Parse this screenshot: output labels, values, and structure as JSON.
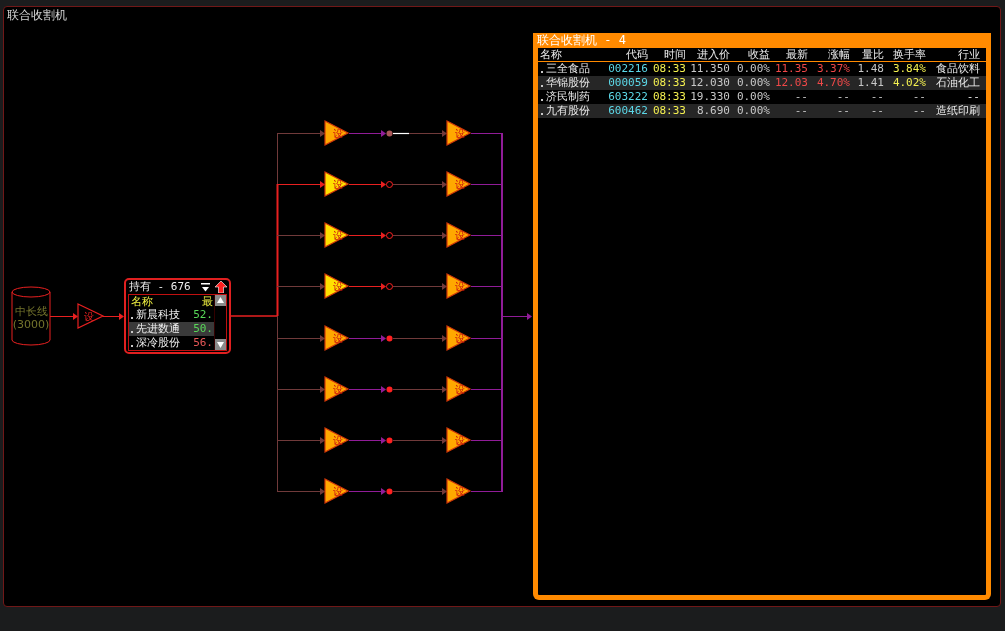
{
  "window": {
    "title": "联合收割机"
  },
  "source": {
    "label": "中长线",
    "count": "(3000)"
  },
  "entry_gate": {
    "label": "设"
  },
  "holdings": {
    "title": "持有 - 676",
    "columns": [
      "名称",
      "最"
    ],
    "rows": [
      {
        "name": "新晨科技",
        "value": "52.",
        "up": false,
        "selected": false
      },
      {
        "name": "先进数通",
        "value": "50.",
        "up": false,
        "selected": true
      },
      {
        "name": "深冷股份",
        "value": "56.",
        "up": true,
        "selected": false
      }
    ]
  },
  "branches": [
    {
      "gate": "设",
      "input_active": false,
      "link_active": false,
      "kind": "faint",
      "trace": true,
      "output_gate": "设"
    },
    {
      "gate": "设",
      "input_active": true,
      "link_active": true,
      "kind": "ring",
      "trace": false,
      "output_gate": "设"
    },
    {
      "gate": "设",
      "input_active": false,
      "link_active": true,
      "kind": "ring",
      "trace": false,
      "output_gate": "设"
    },
    {
      "gate": "设",
      "input_active": false,
      "link_active": true,
      "kind": "ring",
      "trace": false,
      "output_gate": "设"
    },
    {
      "gate": "设",
      "input_active": false,
      "link_active": false,
      "kind": "dot",
      "trace": false,
      "output_gate": "设"
    },
    {
      "gate": "设",
      "input_active": false,
      "link_active": false,
      "kind": "dot",
      "trace": false,
      "output_gate": "设"
    },
    {
      "gate": "设",
      "input_active": false,
      "link_active": false,
      "kind": "dot",
      "trace": false,
      "output_gate": "设"
    },
    {
      "gate": "设",
      "input_active": false,
      "link_active": false,
      "kind": "dot",
      "trace": false,
      "output_gate": "设"
    }
  ],
  "result": {
    "title": "联合收割机 - 4",
    "columns": [
      "名称",
      "代码",
      "时间",
      "进入价",
      "收益",
      "最新",
      "涨幅",
      "量比",
      "换手率",
      "行业"
    ],
    "rows": [
      {
        "up": true,
        "cells": [
          "三全食品",
          "002216",
          "08:33",
          "11.350",
          "0.00%",
          "11.35",
          "3.37%",
          "1.48",
          "3.84%",
          "食品饮料"
        ]
      },
      {
        "up": true,
        "cells": [
          "华锦股份",
          "000059",
          "08:33",
          "12.030",
          "0.00%",
          "12.03",
          "4.70%",
          "1.41",
          "4.02%",
          "石油化工"
        ]
      },
      {
        "up": false,
        "cells": [
          "济民制药",
          "603222",
          "08:33",
          "19.330",
          "0.00%",
          "--",
          "--",
          "--",
          "--",
          "--"
        ]
      },
      {
        "up": false,
        "cells": [
          "九有股份",
          "600462",
          "08:33",
          "8.690",
          "0.00%",
          "--",
          "--",
          "--",
          "--",
          "造纸印刷"
        ]
      }
    ]
  }
}
